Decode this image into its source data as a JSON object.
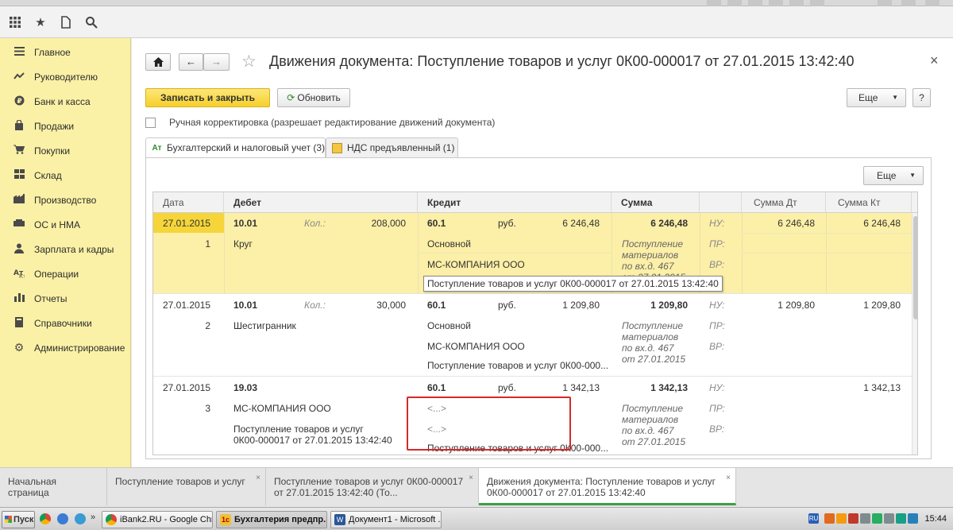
{
  "top_toolbar": {
    "icons": [
      "apps-grid-icon",
      "star-icon",
      "history-icon",
      "search-icon"
    ],
    "right_icons": [
      "info-icon",
      "bell-icon",
      "history-icon",
      "star-icon",
      "zoom-icon",
      "person-icon",
      "minimize-icon",
      "restore-icon",
      "close-icon"
    ]
  },
  "sidebar": {
    "items": [
      {
        "label": "Главное",
        "icon": "menu-icon"
      },
      {
        "label": "Руководителю",
        "icon": "trend-icon"
      },
      {
        "label": "Банк и касса",
        "icon": "ruble-icon"
      },
      {
        "label": "Продажи",
        "icon": "bag-icon"
      },
      {
        "label": "Покупки",
        "icon": "cart-icon"
      },
      {
        "label": "Склад",
        "icon": "warehouse-icon"
      },
      {
        "label": "Производство",
        "icon": "factory-icon"
      },
      {
        "label": "ОС и НМА",
        "icon": "assets-icon"
      },
      {
        "label": "Зарплата и кадры",
        "icon": "person-icon"
      },
      {
        "label": "Операции",
        "icon": "operations-icon"
      },
      {
        "label": "Отчеты",
        "icon": "chart-icon"
      },
      {
        "label": "Справочники",
        "icon": "book-icon"
      },
      {
        "label": "Администрирование",
        "icon": "gear-icon"
      }
    ]
  },
  "document": {
    "title": "Движения документа: Поступление товаров и услуг 0К00-000017 от 27.01.2015 13:42:40",
    "home_icon": "home-icon",
    "back_icon": "arrow-left-icon",
    "forward_icon": "arrow-right-icon",
    "favorite_icon": "star-outline-icon",
    "close_symbol": "×",
    "save_close_label": "Записать и закрыть",
    "refresh_label": "Обновить",
    "more_label": "Еще",
    "help_label": "?",
    "manual_label": "Ручная корректировка (разрешает редактирование движений документа)",
    "manual_checked": false,
    "tabs": [
      {
        "label": "Бухгалтерский и налоговый учет (3)",
        "active": true
      },
      {
        "label": "НДС предъявленный (1)",
        "active": false
      }
    ],
    "grid_more_label": "Еще"
  },
  "grid": {
    "headers": {
      "date": "Дата",
      "debit": "Дебет",
      "credit": "Кредит",
      "sum": "Сумма",
      "sum_dt": "Сумма Дт",
      "sum_kt": "Сумма Кт"
    },
    "rows": [
      {
        "date": "27.01.2015",
        "num": "1",
        "dt_account": "10.01",
        "qty_label": "Кол.:",
        "qty": "208,000",
        "dt_sub1": "Круг",
        "kt_account": "60.1",
        "currency": "руб.",
        "cur_amount": "6 246,48",
        "kt_sub1": "Основной",
        "kt_sub2": "МС-КОМПАНИЯ ООО",
        "kt_sub3_tooltip": "Поступление товаров и услуг 0К00-000017 от 27.01.2015 13:42:40",
        "amount": "6 246,48",
        "memo": [
          "Поступление",
          "материалов",
          "по вх.д. 467",
          "от 27.01.2015"
        ],
        "nu": "НУ:",
        "pr": "ПР:",
        "vr": "ВР:",
        "sum_dt": "6 246,48",
        "sum_kt": "6 246,48"
      },
      {
        "date": "27.01.2015",
        "num": "2",
        "dt_account": "10.01",
        "qty_label": "Кол.:",
        "qty": "30,000",
        "dt_sub1": "Шестигранник",
        "kt_account": "60.1",
        "currency": "руб.",
        "cur_amount": "1 209,80",
        "kt_sub1": "Основной",
        "kt_sub2": "МС-КОМПАНИЯ ООО",
        "kt_sub3": "Поступление товаров и услуг 0К00-000...",
        "amount": "1 209,80",
        "memo": [
          "Поступление",
          "материалов",
          "по вх.д. 467",
          "от 27.01.2015"
        ],
        "nu": "НУ:",
        "pr": "ПР:",
        "vr": "ВР:",
        "sum_dt": "1 209,80",
        "sum_kt": "1 209,80"
      },
      {
        "date": "27.01.2015",
        "num": "3",
        "dt_account": "19.03",
        "dt_sub1": "МС-КОМПАНИЯ ООО",
        "dt_sub2": "Поступление товаров и услуг",
        "dt_sub3": "0К00-000017 от 27.01.2015 13:42:40",
        "kt_account": "60.1",
        "currency": "руб.",
        "cur_amount": "1 342,13",
        "kt_sub1": "<...>",
        "kt_sub2": "<...>",
        "kt_sub3": "Поступление товаров и услуг 0К00-000...",
        "amount": "1 342,13",
        "memo": [
          "Поступление",
          "материалов",
          "по вх.д. 467",
          "от 27.01.2015"
        ],
        "nu": "НУ:",
        "pr": "ПР:",
        "vr": "ВР:",
        "sum_kt": "1 342,13"
      }
    ]
  },
  "open_tabs": [
    {
      "label": "Начальная страница"
    },
    {
      "label": "Поступление товаров и услуг",
      "close": "×"
    },
    {
      "label": "Поступление товаров и услуг 0К00-000017 от 27.01.2015 13:42:40 (То...",
      "close": "×"
    },
    {
      "label": "Движения документа: Поступление товаров и услуг 0К00-000017 от 27.01.2015 13:42:40",
      "close": "×",
      "active": true
    }
  ],
  "taskbar": {
    "start_label": "Пуск",
    "apps": [
      "iBank2.RU - Google Chrome",
      "Бухгалтерия предпр...",
      "Документ1 - Microsoft ..."
    ],
    "chevron": "»",
    "lang": "RU",
    "clock": "15:44"
  },
  "colors": {
    "accent": "#f6cf2a",
    "sidebar": "#fbf1a6",
    "selected_row": "#fcefa7",
    "highlight_box": "#d42a2a",
    "active_tab": "#3f9e44"
  }
}
